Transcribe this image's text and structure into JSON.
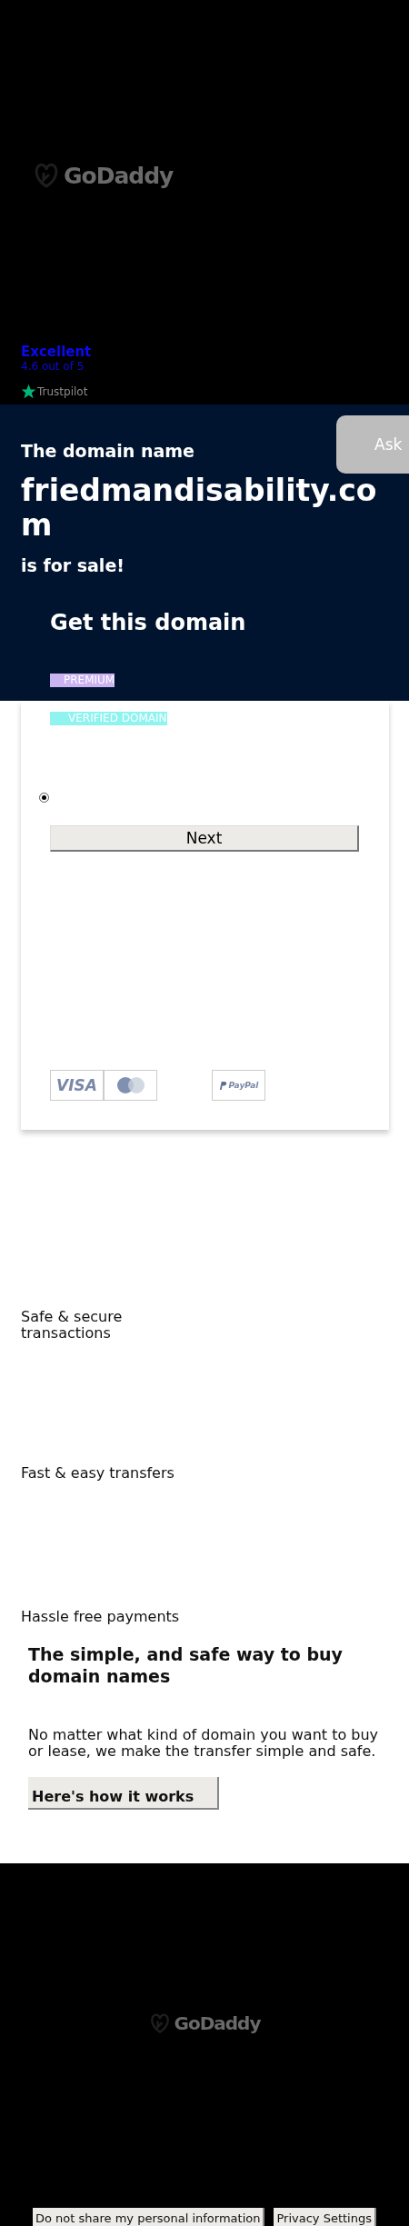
{
  "header": {
    "logo": "GoDaddy",
    "rating": {
      "label": "Excellent",
      "score": "4.6 out of 5",
      "source": "Trustpilot"
    }
  },
  "hero": {
    "intro": "The domain name",
    "domain": "friedmandisability.com",
    "outro": "is for sale!",
    "ask_button": "Ask"
  },
  "purchase_card": {
    "title": "Get this domain",
    "badges": [
      {
        "label": "PREMIUM",
        "color": "#c9b3f0"
      },
      {
        "label": "VERIFIED DOMAIN",
        "color": "#8ff3ef"
      }
    ],
    "option": {
      "selected": true
    },
    "next_button": "Next",
    "payment_methods": [
      "VISA",
      "PayPal"
    ]
  },
  "features": [
    "Safe & secure\ntransactions",
    "Fast & easy transfers",
    "Hassle free payments"
  ],
  "info": {
    "title": "The simple, and safe way to buy domain names",
    "text": "No matter what kind of domain you want to buy or lease, we make the transfer simple and safe.",
    "button": "Here's how it works"
  },
  "footer": {
    "logo": "GoDaddy",
    "buttons": [
      "Do not share my personal information",
      "Privacy Settings"
    ]
  }
}
